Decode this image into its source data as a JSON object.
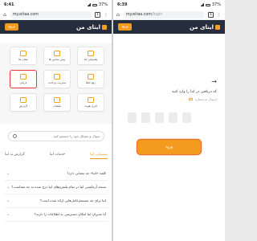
{
  "left": {
    "status": {
      "time": "6:41",
      "battery": "37%"
    },
    "browser": {
      "url": "my.eitaa.com",
      "tab_count": "1"
    },
    "header": {
      "brand": "ایتای من",
      "login_label": "ورود"
    },
    "tiles": [
      {
        "label": "پشتیبانی ایتا",
        "icon": "support-icon"
      },
      {
        "label": "پیش نمایش ها",
        "icon": "preview-icon"
      },
      {
        "label": "نشان ها",
        "icon": "badge-icon"
      },
      {
        "label": "رفع خطا",
        "icon": "wrench-icon"
      },
      {
        "label": "مدیریت پرداخت",
        "icon": "payment-icon"
      },
      {
        "label": "بازیابی",
        "icon": "restore-icon"
      },
      {
        "label": "احراز هویت",
        "icon": "id-card-icon"
      },
      {
        "label": "تبلیغات",
        "icon": "ads-icon"
      },
      {
        "label": "گزارش",
        "icon": "report-icon"
      }
    ],
    "search": {
      "placeholder": "سوال و مشکل خود را جستجو کنید"
    },
    "tabs": [
      "پشتیبانی ایتا",
      "خدمات ایتا",
      "گزارش به ایتا"
    ],
    "faq": [
      "کلمه «ایتا» چه معنایی دارد؟",
      "نسخه آزمایشی ایتا در تمام پلتفرم‌های ایتا درج شده به چه معناست؟",
      "ایتا برای چه سیستم‌عامل‌هایی ارائه شده است؟",
      "آیا مدیران ایتا امکان دسترسی به اطلاعات را دارند؟"
    ]
  },
  "right": {
    "status": {
      "time": "6:39",
      "battery": "37%"
    },
    "browser": {
      "url": "my.eitaa.com",
      "url_path": "/login",
      "tab_count": "1"
    },
    "header": {
      "brand": "ایتای من",
      "login_label": "ورود"
    },
    "back_arrow": "→",
    "title": "کد دریافتی در ایتا را وارد کنید",
    "subtitle": "ارسال به شماره",
    "code_boxes": 5,
    "enter_label": "ورود"
  }
}
